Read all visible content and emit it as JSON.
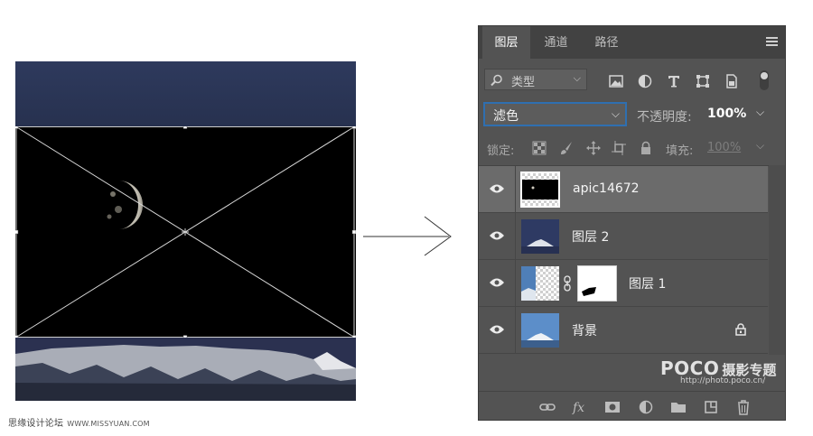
{
  "panel": {
    "tabs": [
      {
        "label": "图层",
        "active": true
      },
      {
        "label": "通道",
        "active": false
      },
      {
        "label": "路径",
        "active": false
      }
    ],
    "filter": {
      "label": "类型"
    },
    "blend_mode": {
      "value": "滤色"
    },
    "opacity": {
      "label": "不透明度:",
      "value": "100%"
    },
    "lock": {
      "label": "锁定:"
    },
    "fill": {
      "label": "填充:",
      "value": "100%"
    },
    "layers": [
      {
        "name": "apic14672",
        "visible": true,
        "selected": true,
        "has_mask": false,
        "locked": false
      },
      {
        "name": "图层 2",
        "visible": true,
        "selected": false,
        "has_mask": false,
        "locked": false
      },
      {
        "name": "图层 1",
        "visible": true,
        "selected": false,
        "has_mask": true,
        "locked": false
      },
      {
        "name": "背景",
        "visible": true,
        "selected": false,
        "has_mask": false,
        "locked": true
      }
    ],
    "logo": {
      "brand": "POCO",
      "subtitle": "摄影专题",
      "url": "http://photo.poco.cn/"
    }
  },
  "watermark": {
    "text": "思缘设计论坛",
    "url": "WWW.MISSYUAN.COM"
  },
  "colors": {
    "panel_bg": "#535353",
    "tab_bar": "#424242",
    "selected_row": "#6b6b6b",
    "blend_focus": "#2f6fb0",
    "night_sky": "#2b3453"
  },
  "icons": {
    "filter": [
      "image-filter-icon",
      "adjustment-filter-icon",
      "type-filter-icon",
      "shape-filter-icon",
      "smart-object-filter-icon",
      "filter-toggle-icon"
    ],
    "lock": [
      "lock-transparent-icon",
      "lock-image-icon",
      "lock-position-icon",
      "lock-artboard-icon",
      "lock-all-icon"
    ],
    "bottom": [
      "link-layers-icon",
      "fx-icon",
      "add-mask-icon",
      "adjustment-layer-icon",
      "group-icon",
      "new-layer-icon",
      "delete-icon"
    ]
  }
}
